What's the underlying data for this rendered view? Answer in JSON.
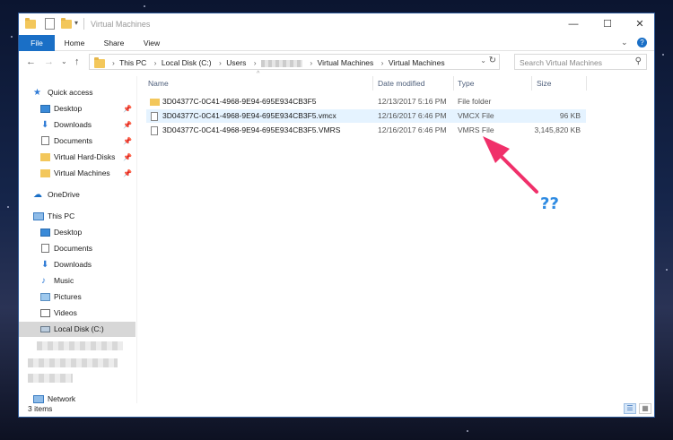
{
  "window": {
    "title": "Virtual Machines"
  },
  "window_controls": {
    "minimize": "—",
    "maximize": "☐",
    "close": "✕"
  },
  "ribbon": {
    "tabs": [
      "File",
      "Home",
      "Share",
      "View"
    ],
    "expand_icon": "chevron-down-icon",
    "help_icon": "help-icon",
    "expand_glyph": "⌄",
    "help_glyph": "?"
  },
  "nav": {
    "back": "←",
    "forward": "→",
    "recent": "⌄",
    "up": "↑"
  },
  "address": {
    "segments": [
      "This PC",
      "Local Disk (C:)",
      "Users",
      "Virtual Machines",
      "Virtual Machines"
    ],
    "dropdown": "⌄",
    "refresh": "↻"
  },
  "search": {
    "placeholder": "Search Virtual Machines",
    "icon_glyph": "⚲"
  },
  "sidebar": {
    "quick_access": "Quick access",
    "pinned": [
      {
        "label": "Desktop",
        "icon": "desktop-icon"
      },
      {
        "label": "Downloads",
        "icon": "downloads-icon"
      },
      {
        "label": "Documents",
        "icon": "documents-icon"
      },
      {
        "label": "Virtual Hard-Disks",
        "icon": "folder-icon"
      },
      {
        "label": "Virtual Machines",
        "icon": "folder-icon"
      }
    ],
    "onedrive": "OneDrive",
    "this_pc": "This PC",
    "pc_items": [
      {
        "label": "Desktop",
        "icon": "desktop-icon"
      },
      {
        "label": "Documents",
        "icon": "documents-icon"
      },
      {
        "label": "Downloads",
        "icon": "downloads-icon"
      },
      {
        "label": "Music",
        "icon": "music-icon"
      },
      {
        "label": "Pictures",
        "icon": "pictures-icon"
      },
      {
        "label": "Videos",
        "icon": "videos-icon"
      },
      {
        "label": "Local Disk (C:)",
        "icon": "drive-icon"
      }
    ],
    "network": "Network"
  },
  "columns": {
    "name": "Name",
    "date": "Date modified",
    "type": "Type",
    "size": "Size"
  },
  "files": [
    {
      "name": "3D04377C-0C41-4968-9E94-695E934CB3F5",
      "date": "12/13/2017 5:16 PM",
      "type": "File folder",
      "size": "",
      "kind": "folder"
    },
    {
      "name": "3D04377C-0C41-4968-9E94-695E934CB3F5.vmcx",
      "date": "12/16/2017 6:46 PM",
      "type": "VMCX File",
      "size": "96 KB",
      "kind": "file"
    },
    {
      "name": "3D04377C-0C41-4968-9E94-695E934CB3F5.VMRS",
      "date": "12/16/2017 6:46 PM",
      "type": "VMRS File",
      "size": "3,145,820 KB",
      "kind": "file"
    }
  ],
  "status": {
    "item_count": "3 items"
  },
  "annotation": {
    "text": "??",
    "arrow_color": "#f0306a",
    "text_color": "#2f8be2"
  }
}
